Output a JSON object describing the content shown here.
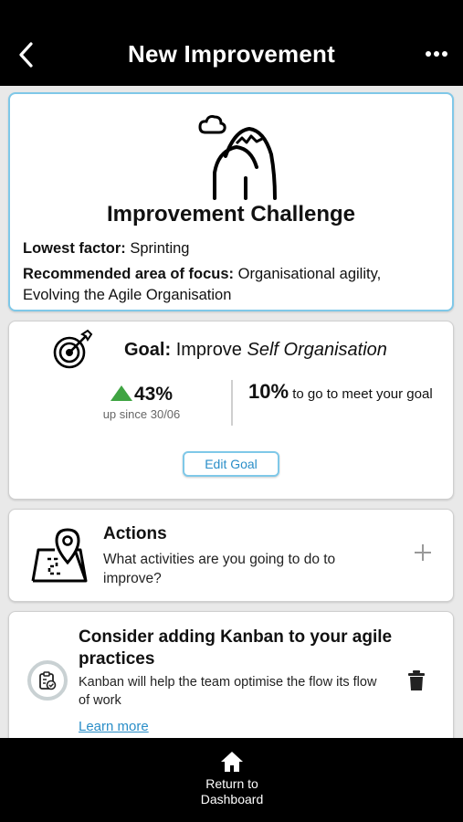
{
  "header": {
    "title": "New Improvement",
    "back_icon": "chevron-left-icon",
    "more_icon": "ellipsis-icon"
  },
  "challenge": {
    "icon": "mountain-icon",
    "title": "Improvement Challenge",
    "lowest_factor_label": "Lowest factor:",
    "lowest_factor_value": "Sprinting",
    "focus_label": "Recommended area of focus:",
    "focus_value": "Organisational agility, Evolving the Agile Organisation"
  },
  "goal": {
    "icon": "target-icon",
    "label": "Goal:",
    "text": "Improve",
    "focus": "Self Organisation",
    "change": "43%",
    "change_sub": "up since 30/06",
    "remaining": "10%",
    "remaining_text": "to go to meet your goal",
    "edit_label": "Edit Goal",
    "accent": "#3fa442"
  },
  "actions": {
    "icon": "map-pin-icon",
    "title": "Actions",
    "description": "What activities are you going to do to improve?",
    "add_icon": "plus-icon"
  },
  "suggestion": {
    "icon": "clipboard-check-icon",
    "title": "Consider adding Kanban to your agile practices",
    "description": "Kanban will help the team optimise the flow its flow of work",
    "link": "Learn more",
    "delete_icon": "trash-icon"
  },
  "footer": {
    "home_icon": "home-icon",
    "label_line1": "Return to",
    "label_line2": "Dashboard"
  },
  "colors": {
    "bar": "#000000",
    "link": "#2a8ec8",
    "card_border_highlight": "#7fc8e8"
  }
}
